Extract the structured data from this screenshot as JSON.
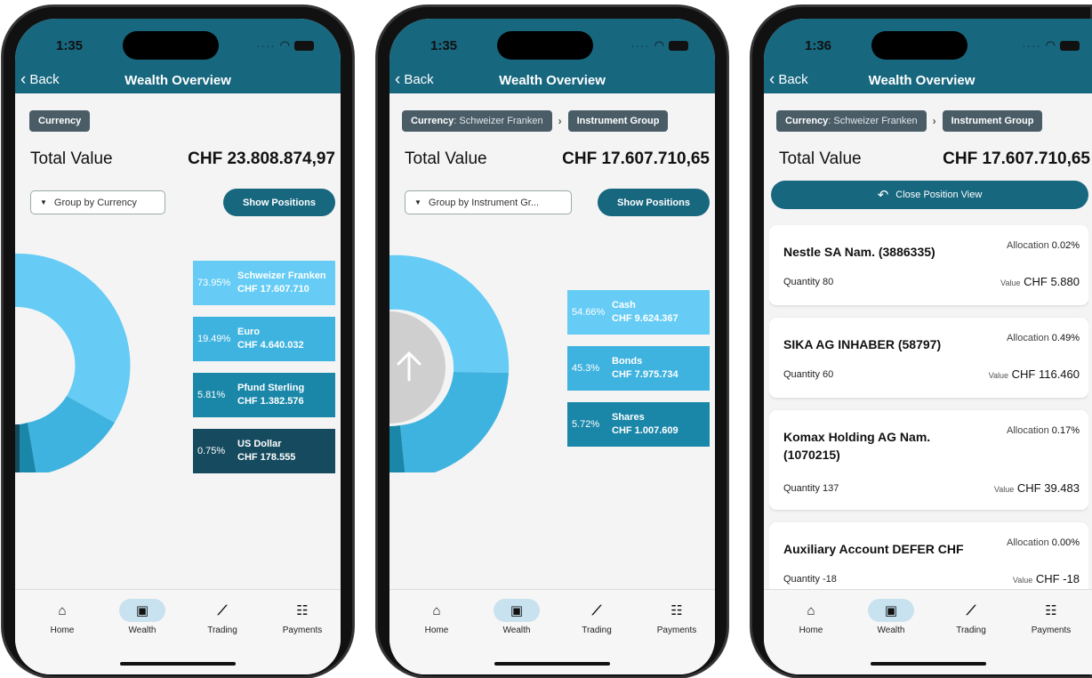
{
  "colors": {
    "header": "#17677f",
    "slice_light": "#66ccf5",
    "slice_mid": "#3fb3e0",
    "slice_dark": "#1a87a9",
    "slice_darkest": "#164a5e"
  },
  "screens": [
    {
      "status_time": "1:35",
      "back_label": "Back",
      "title": "Wealth Overview",
      "breadcrumb": [
        {
          "label": "Currency",
          "value": ""
        }
      ],
      "total_label": "Total Value",
      "total_value": "CHF 23.808.874,97",
      "group_select": "Group by Currency",
      "show_positions": "Show Positions",
      "legend": [
        {
          "pct": "73.95%",
          "name": "Schweizer Franken",
          "value": "CHF 17.607.710",
          "share": 73.95
        },
        {
          "pct": "19.49%",
          "name": "Euro",
          "value": "CHF 4.640.032",
          "share": 19.49
        },
        {
          "pct": "5.81%",
          "name": "Pfund Sterling",
          "value": "CHF 1.382.576",
          "share": 5.81
        },
        {
          "pct": "0.75%",
          "name": "US Dollar",
          "value": "CHF 178.555",
          "share": 0.75
        }
      ]
    },
    {
      "status_time": "1:35",
      "back_label": "Back",
      "title": "Wealth Overview",
      "breadcrumb": [
        {
          "label": "Currency",
          "value": ": Schweizer Franken"
        },
        {
          "label": "Instrument Group",
          "value": ""
        }
      ],
      "total_label": "Total Value",
      "total_value": "CHF 17.607.710,65",
      "group_select": "Group by Instrument Gr...",
      "show_positions": "Show Positions",
      "legend": [
        {
          "pct": "54.66%",
          "name": "Cash",
          "value": "CHF 9.624.367",
          "share": 54.66
        },
        {
          "pct": "45.3%",
          "name": "Bonds",
          "value": "CHF 7.975.734",
          "share": 45.3
        },
        {
          "pct": "5.72%",
          "name": "Shares",
          "value": "CHF 1.007.609",
          "share": 5.72
        }
      ],
      "up_icon": "arrow-up-icon"
    },
    {
      "status_time": "1:36",
      "back_label": "Back",
      "title": "Wealth Overview",
      "breadcrumb": [
        {
          "label": "Currency",
          "value": ": Schweizer Franken"
        },
        {
          "label": "Instrument Group",
          "value": ""
        }
      ],
      "total_label": "Total Value",
      "total_value": "CHF 17.607.710,65",
      "close_position_view": "Close Position View",
      "positions": [
        {
          "name": "Nestle SA Nam. (3886335)",
          "allocation_label": "Allocation",
          "allocation": "0.02%",
          "quantity": "Quantity 80",
          "value_label": "Value",
          "value": "CHF 5.880"
        },
        {
          "name": "SIKA AG INHABER (58797)",
          "allocation_label": "Allocation",
          "allocation": "0.49%",
          "quantity": "Quantity 60",
          "value_label": "Value",
          "value": "CHF 116.460"
        },
        {
          "name": "Komax Holding AG Nam. (1070215)",
          "allocation_label": "Allocation",
          "allocation": "0.17%",
          "quantity": "Quantity 137",
          "value_label": "Value",
          "value": "CHF 39.483"
        },
        {
          "name": "Auxiliary Account DEFER CHF",
          "allocation_label": "Allocation",
          "allocation": "0.00%",
          "quantity": "Quantity -18",
          "value_label": "Value",
          "value": "CHF -18"
        }
      ]
    }
  ],
  "bottom_nav": [
    {
      "label": "Home",
      "icon": "home-icon"
    },
    {
      "label": "Wealth",
      "icon": "wallet-icon",
      "active": true
    },
    {
      "label": "Trading",
      "icon": "trend-icon"
    },
    {
      "label": "Payments",
      "icon": "payments-icon"
    }
  ]
}
